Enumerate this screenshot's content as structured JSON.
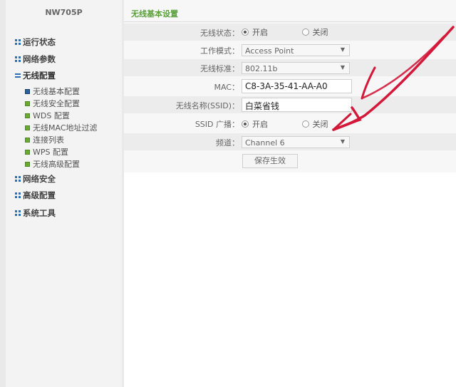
{
  "sidebar": {
    "brand": "NW705P",
    "menu": [
      {
        "label": "运行状态",
        "icon": "grid-icon"
      },
      {
        "label": "网络参数",
        "icon": "grid-icon"
      },
      {
        "label": "无线配置",
        "icon": "list-icon"
      },
      {
        "label": "网络安全",
        "icon": "grid-icon"
      },
      {
        "label": "高级配置",
        "icon": "grid-icon"
      },
      {
        "label": "系统工具",
        "icon": "grid-icon"
      }
    ],
    "submenu": [
      {
        "label": "无线基本配置",
        "current": true
      },
      {
        "label": "无线安全配置"
      },
      {
        "label": "WDS 配置"
      },
      {
        "label": "无线MAC地址过滤"
      },
      {
        "label": "连接列表"
      },
      {
        "label": "WPS 配置"
      },
      {
        "label": "无线高级配置"
      }
    ]
  },
  "main": {
    "title": "无线基本设置",
    "fields": {
      "wireless_status": {
        "label": "无线状态：",
        "options": [
          "开启",
          "关闭"
        ],
        "selected": "开启"
      },
      "work_mode": {
        "label": "工作模式：",
        "value": "Access Point"
      },
      "wireless_standard": {
        "label": "无线标准：",
        "value": "802.11b"
      },
      "mac": {
        "label": "MAC：",
        "value": "C8-3A-35-41-AA-A0"
      },
      "ssid": {
        "label": "无线名称(SSID)：",
        "value": "白菜省钱"
      },
      "ssid_broadcast": {
        "label": "SSID 广播：",
        "options": [
          "开启",
          "关闭"
        ],
        "selected": "开启"
      },
      "channel": {
        "label": "频道：",
        "value": "Channel 6"
      }
    },
    "save_label": "保存生效"
  },
  "colors": {
    "accent_green": "#5aa03b",
    "annotation_red": "#d4183a",
    "icon_blue": "#2c6fb6"
  }
}
